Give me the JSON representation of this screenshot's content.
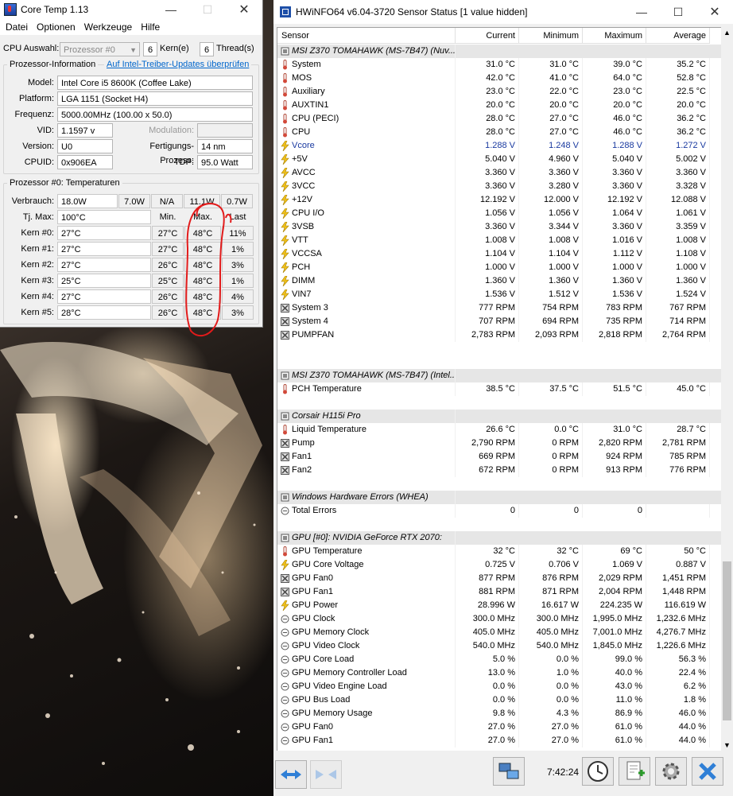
{
  "coretemp": {
    "title": "Core Temp 1.13",
    "menu": [
      "Datei",
      "Optionen",
      "Werkzeuge",
      "Hilfe"
    ],
    "cpu_select_label": "CPU Auswahl:",
    "cpu_select_value": "Prozessor #0",
    "cores_value": "6",
    "cores_label": "Kern(e)",
    "threads_value": "6",
    "threads_label": "Thread(s)",
    "info_group_title": "Prozessor-Information",
    "driver_link": "Auf Intel-Treiber-Updates überprüfen",
    "model_label": "Model:",
    "model_value": "Intel Core i5 8600K (Coffee Lake)",
    "platform_label": "Platform:",
    "platform_value": "LGA 1151 (Socket H4)",
    "freq_label": "Frequenz:",
    "freq_value": "5000.00MHz (100.00 x 50.0)",
    "vid_label": "VID:",
    "vid_value": "1.1597 v",
    "modulation_label": "Modulation:",
    "modulation_value": "",
    "version_label": "Version:",
    "version_value": "U0",
    "process_label": "Fertigungs-Prozess:",
    "process_value": "14 nm",
    "cpuid_label": "CPUID:",
    "cpuid_value": "0x906EA",
    "tdp_label": "TDP:",
    "tdp_value": "95.0 Watt",
    "temp_group_title": "Prozessor #0: Temperaturen",
    "power_label": "Verbrauch:",
    "power_values": [
      "18.0W",
      "7.0W",
      "N/A",
      "11.1W",
      "0.7W"
    ],
    "tjmax_label": "Tj. Max:",
    "tjmax_value": "100°C",
    "col_min": "Min.",
    "col_max": "Max.",
    "col_last": "Last",
    "cores": [
      {
        "label": "Kern #0:",
        "temp": "27°C",
        "min": "27°C",
        "max": "48°C",
        "load": "11%"
      },
      {
        "label": "Kern #1:",
        "temp": "27°C",
        "min": "27°C",
        "max": "48°C",
        "load": "1%"
      },
      {
        "label": "Kern #2:",
        "temp": "27°C",
        "min": "26°C",
        "max": "48°C",
        "load": "3%"
      },
      {
        "label": "Kern #3:",
        "temp": "25°C",
        "min": "25°C",
        "max": "48°C",
        "load": "1%"
      },
      {
        "label": "Kern #4:",
        "temp": "27°C",
        "min": "26°C",
        "max": "48°C",
        "load": "4%"
      },
      {
        "label": "Kern #5:",
        "temp": "28°C",
        "min": "26°C",
        "max": "48°C",
        "load": "3%"
      }
    ]
  },
  "hwinfo": {
    "title": "HWiNFO64 v6.04-3720 Sensor Status [1 value hidden]",
    "columns": [
      "Sensor",
      "Current",
      "Minimum",
      "Maximum",
      "Average"
    ],
    "time": "7:42:24",
    "rows": [
      {
        "type": "group",
        "name": "MSI Z370 TOMAHAWK (MS-7B47) (Nuv..."
      },
      {
        "type": "temp",
        "name": "System",
        "cur": "31.0 °C",
        "min": "31.0 °C",
        "max": "39.0 °C",
        "avg": "35.2 °C"
      },
      {
        "type": "temp",
        "name": "MOS",
        "cur": "42.0 °C",
        "min": "41.0 °C",
        "max": "64.0 °C",
        "avg": "52.8 °C"
      },
      {
        "type": "temp",
        "name": "Auxiliary",
        "cur": "23.0 °C",
        "min": "22.0 °C",
        "max": "23.0 °C",
        "avg": "22.5 °C"
      },
      {
        "type": "temp",
        "name": "AUXTIN1",
        "cur": "20.0 °C",
        "min": "20.0 °C",
        "max": "20.0 °C",
        "avg": "20.0 °C"
      },
      {
        "type": "temp",
        "name": "CPU (PECI)",
        "cur": "28.0 °C",
        "min": "27.0 °C",
        "max": "46.0 °C",
        "avg": "36.2 °C"
      },
      {
        "type": "temp",
        "name": "CPU",
        "cur": "28.0 °C",
        "min": "27.0 °C",
        "max": "46.0 °C",
        "avg": "36.2 °C"
      },
      {
        "type": "volt",
        "name": "Vcore",
        "cur": "1.288 V",
        "min": "1.248 V",
        "max": "1.288 V",
        "avg": "1.272 V",
        "blue": true
      },
      {
        "type": "volt",
        "name": "+5V",
        "cur": "5.040 V",
        "min": "4.960 V",
        "max": "5.040 V",
        "avg": "5.002 V"
      },
      {
        "type": "volt",
        "name": "AVCC",
        "cur": "3.360 V",
        "min": "3.360 V",
        "max": "3.360 V",
        "avg": "3.360 V"
      },
      {
        "type": "volt",
        "name": "3VCC",
        "cur": "3.360 V",
        "min": "3.280 V",
        "max": "3.360 V",
        "avg": "3.328 V"
      },
      {
        "type": "volt",
        "name": "+12V",
        "cur": "12.192 V",
        "min": "12.000 V",
        "max": "12.192 V",
        "avg": "12.088 V"
      },
      {
        "type": "volt",
        "name": "CPU I/O",
        "cur": "1.056 V",
        "min": "1.056 V",
        "max": "1.064 V",
        "avg": "1.061 V"
      },
      {
        "type": "volt",
        "name": "3VSB",
        "cur": "3.360 V",
        "min": "3.344 V",
        "max": "3.360 V",
        "avg": "3.359 V"
      },
      {
        "type": "volt",
        "name": "VTT",
        "cur": "1.008 V",
        "min": "1.008 V",
        "max": "1.016 V",
        "avg": "1.008 V"
      },
      {
        "type": "volt",
        "name": "VCCSA",
        "cur": "1.104 V",
        "min": "1.104 V",
        "max": "1.112 V",
        "avg": "1.108 V"
      },
      {
        "type": "volt",
        "name": "PCH",
        "cur": "1.000 V",
        "min": "1.000 V",
        "max": "1.000 V",
        "avg": "1.000 V"
      },
      {
        "type": "volt",
        "name": "DIMM",
        "cur": "1.360 V",
        "min": "1.360 V",
        "max": "1.360 V",
        "avg": "1.360 V"
      },
      {
        "type": "volt",
        "name": "VIN7",
        "cur": "1.536 V",
        "min": "1.512 V",
        "max": "1.536 V",
        "avg": "1.524 V"
      },
      {
        "type": "fan",
        "name": "System 3",
        "cur": "777 RPM",
        "min": "754 RPM",
        "max": "783 RPM",
        "avg": "767 RPM"
      },
      {
        "type": "fan",
        "name": "System 4",
        "cur": "707 RPM",
        "min": "694 RPM",
        "max": "735 RPM",
        "avg": "714 RPM"
      },
      {
        "type": "fan",
        "name": "PUMPFAN",
        "cur": "2,783 RPM",
        "min": "2,093 RPM",
        "max": "2,818 RPM",
        "avg": "2,764 RPM"
      },
      {
        "type": "blank"
      },
      {
        "type": "blank"
      },
      {
        "type": "group",
        "name": "MSI Z370 TOMAHAWK (MS-7B47) (Intel..."
      },
      {
        "type": "temp",
        "name": "PCH Temperature",
        "cur": "38.5 °C",
        "min": "37.5 °C",
        "max": "51.5 °C",
        "avg": "45.0 °C"
      },
      {
        "type": "blank"
      },
      {
        "type": "group",
        "name": "Corsair H115i Pro"
      },
      {
        "type": "temp",
        "name": "Liquid Temperature",
        "cur": "26.6 °C",
        "min": "0.0 °C",
        "max": "31.0 °C",
        "avg": "28.7 °C"
      },
      {
        "type": "fan",
        "name": "Pump",
        "cur": "2,790 RPM",
        "min": "0 RPM",
        "max": "2,820 RPM",
        "avg": "2,781 RPM"
      },
      {
        "type": "fan",
        "name": "Fan1",
        "cur": "669 RPM",
        "min": "0 RPM",
        "max": "924 RPM",
        "avg": "785 RPM"
      },
      {
        "type": "fan",
        "name": "Fan2",
        "cur": "672 RPM",
        "min": "0 RPM",
        "max": "913 RPM",
        "avg": "776 RPM"
      },
      {
        "type": "blank"
      },
      {
        "type": "group",
        "name": "Windows Hardware Errors (WHEA)"
      },
      {
        "type": "other",
        "name": "Total Errors",
        "cur": "0",
        "min": "0",
        "max": "0",
        "avg": ""
      },
      {
        "type": "blank"
      },
      {
        "type": "group",
        "name": "GPU [#0]: NVIDIA GeForce RTX 2070:"
      },
      {
        "type": "temp",
        "name": "GPU Temperature",
        "cur": "32 °C",
        "min": "32 °C",
        "max": "69 °C",
        "avg": "50 °C"
      },
      {
        "type": "volt",
        "name": "GPU Core Voltage",
        "cur": "0.725 V",
        "min": "0.706 V",
        "max": "1.069 V",
        "avg": "0.887 V"
      },
      {
        "type": "fan",
        "name": "GPU Fan0",
        "cur": "877 RPM",
        "min": "876 RPM",
        "max": "2,029 RPM",
        "avg": "1,451 RPM"
      },
      {
        "type": "fan",
        "name": "GPU Fan1",
        "cur": "881 RPM",
        "min": "871 RPM",
        "max": "2,004 RPM",
        "avg": "1,448 RPM"
      },
      {
        "type": "volt",
        "name": "GPU Power",
        "cur": "28.996 W",
        "min": "16.617 W",
        "max": "224.235 W",
        "avg": "116.619 W"
      },
      {
        "type": "other",
        "name": "GPU Clock",
        "cur": "300.0 MHz",
        "min": "300.0 MHz",
        "max": "1,995.0 MHz",
        "avg": "1,232.6 MHz"
      },
      {
        "type": "other",
        "name": "GPU Memory Clock",
        "cur": "405.0 MHz",
        "min": "405.0 MHz",
        "max": "7,001.0 MHz",
        "avg": "4,276.7 MHz"
      },
      {
        "type": "other",
        "name": "GPU Video Clock",
        "cur": "540.0 MHz",
        "min": "540.0 MHz",
        "max": "1,845.0 MHz",
        "avg": "1,226.6 MHz"
      },
      {
        "type": "other",
        "name": "GPU Core Load",
        "cur": "5.0 %",
        "min": "0.0 %",
        "max": "99.0 %",
        "avg": "56.3 %"
      },
      {
        "type": "other",
        "name": "GPU Memory Controller Load",
        "cur": "13.0 %",
        "min": "1.0 %",
        "max": "40.0 %",
        "avg": "22.4 %"
      },
      {
        "type": "other",
        "name": "GPU Video Engine Load",
        "cur": "0.0 %",
        "min": "0.0 %",
        "max": "43.0 %",
        "avg": "6.2 %"
      },
      {
        "type": "other",
        "name": "GPU Bus Load",
        "cur": "0.0 %",
        "min": "0.0 %",
        "max": "11.0 %",
        "avg": "1.8 %"
      },
      {
        "type": "other",
        "name": "GPU Memory Usage",
        "cur": "9.8 %",
        "min": "4.3 %",
        "max": "86.9 %",
        "avg": "46.0 %"
      },
      {
        "type": "other",
        "name": "GPU Fan0",
        "cur": "27.0 %",
        "min": "27.0 %",
        "max": "61.0 %",
        "avg": "44.0 %"
      },
      {
        "type": "other",
        "name": "GPU Fan1",
        "cur": "27.0 %",
        "min": "27.0 %",
        "max": "61.0 %",
        "avg": "44.0 %"
      }
    ]
  }
}
